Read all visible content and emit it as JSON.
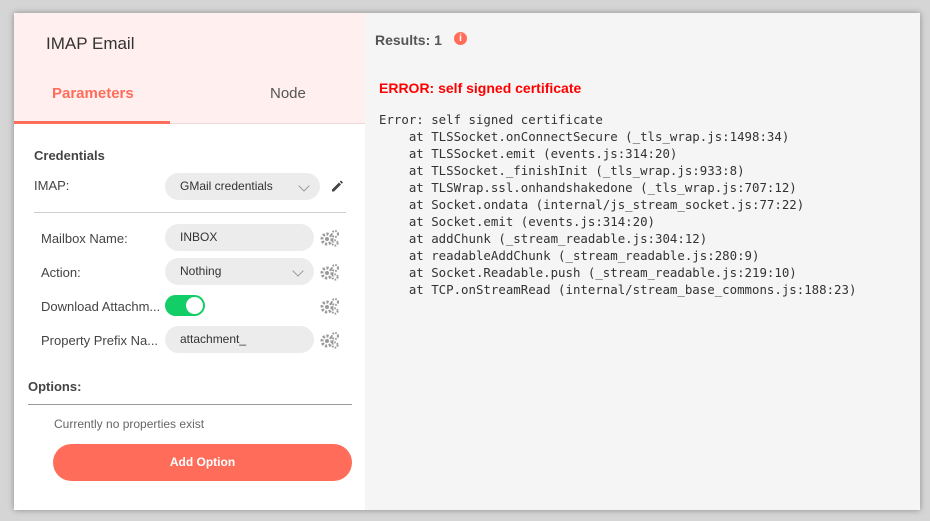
{
  "node": {
    "title": "IMAP Email",
    "tabs": [
      "Parameters",
      "Node"
    ]
  },
  "credentials": {
    "section_title": "Credentials",
    "imap_label": "IMAP:",
    "imap_value": "GMail credentials"
  },
  "params": {
    "mailbox_label": "Mailbox Name:",
    "mailbox_value": "INBOX",
    "action_label": "Action:",
    "action_value": "Nothing",
    "download_label": "Download Attachm...",
    "download_on": true,
    "prefix_label": "Property Prefix Na...",
    "prefix_value": "attachment_"
  },
  "options": {
    "title": "Options:",
    "empty_text": "Currently no properties exist",
    "add_button": "Add Option"
  },
  "results": {
    "label": "Results: 1",
    "info_icon": "i",
    "error_title": "ERROR: self signed certificate",
    "stack_lines": [
      "Error: self signed certificate",
      "    at TLSSocket.onConnectSecure (_tls_wrap.js:1498:34)",
      "    at TLSSocket.emit (events.js:314:20)",
      "    at TLSSocket._finishInit (_tls_wrap.js:933:8)",
      "    at TLSWrap.ssl.onhandshakedone (_tls_wrap.js:707:12)",
      "    at Socket.ondata (internal/js_stream_socket.js:77:22)",
      "    at Socket.emit (events.js:314:20)",
      "    at addChunk (_stream_readable.js:304:12)",
      "    at readableAddChunk (_stream_readable.js:280:9)",
      "    at Socket.Readable.push (_stream_readable.js:219:10)",
      "    at TCP.onStreamRead (internal/stream_base_commons.js:188:23)"
    ]
  },
  "colors": {
    "accent": "#ff6d5a",
    "error": "#ff0000",
    "toggle_on": "#13ce66"
  },
  "icons": {
    "edit": "pencil-icon",
    "settings": "gears-icon",
    "info": "info-icon",
    "dropdown": "chevron-down-icon"
  }
}
